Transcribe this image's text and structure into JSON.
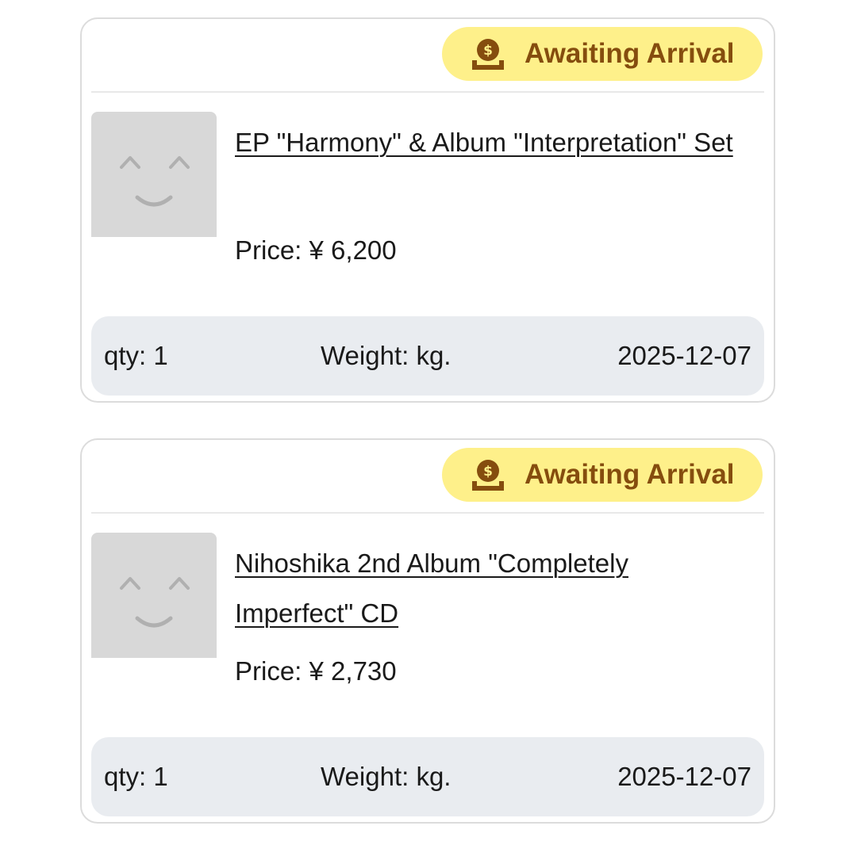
{
  "orders": [
    {
      "status": "Awaiting Arrival",
      "status_icon": "coin-in-tray-icon",
      "product_name": "EP \"Harmony\" & Album \"Interpretation\" Set",
      "price": "Price: ¥ 6,200",
      "qty": "qty: 1",
      "weight": "Weight: kg.",
      "date": "2025-12-07",
      "thumbnail": "placeholder-smiley-image"
    },
    {
      "status": "Awaiting Arrival",
      "status_icon": "coin-in-tray-icon",
      "product_name": "Nihoshika 2nd Album \"Completely Imperfect\" CD",
      "price": "Price: ¥ 2,730",
      "qty": "qty: 1",
      "weight": "Weight: kg.",
      "date": "2025-12-07",
      "thumbnail": "placeholder-smiley-image"
    }
  ],
  "colors": {
    "badge_bg": "#fef08a",
    "badge_text": "#854d0e",
    "info_bar_bg": "#e9ecf0",
    "card_border": "#dcdcdc",
    "thumb_bg": "#d8d8d8"
  }
}
